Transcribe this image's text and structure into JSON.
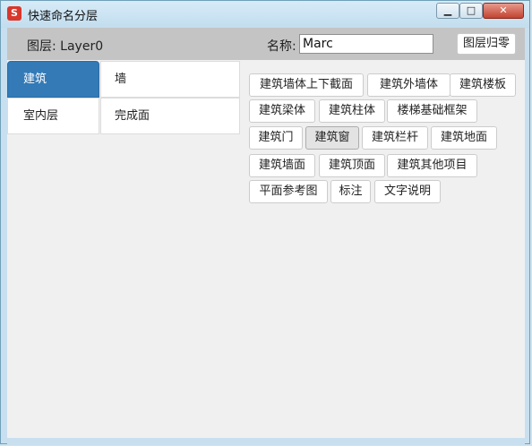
{
  "window": {
    "title": "快速命名分层",
    "min_glyph": "▁",
    "max_glyph": "□",
    "close_glyph": "✕",
    "app_icon": "S"
  },
  "header": {
    "layer_text": "图层: Layer0",
    "name_label": "名称:",
    "name_value": "Marc",
    "reset_label": "图层归零"
  },
  "categories": [
    {
      "label": "建筑"
    },
    {
      "label": "室内层"
    }
  ],
  "subcategories": [
    {
      "label": "墙"
    },
    {
      "label": "完成面"
    }
  ],
  "layer_buttons": [
    {
      "label": "建筑墙体上下截面"
    },
    {
      "label": "建筑外墙体"
    },
    {
      "label": "建筑楼板"
    },
    {
      "label": "建筑梁体"
    },
    {
      "label": "建筑柱体"
    },
    {
      "label": "楼梯基础框架"
    },
    {
      "label": "建筑门"
    },
    {
      "label": "建筑窗"
    },
    {
      "label": "建筑栏杆"
    },
    {
      "label": "建筑地面"
    },
    {
      "label": "建筑墙面"
    },
    {
      "label": "建筑顶面"
    },
    {
      "label": "建筑其他项目"
    },
    {
      "label": "平面参考图"
    },
    {
      "label": "标注"
    },
    {
      "label": "文字说明"
    }
  ],
  "colors": {
    "active_category": "#337ab7",
    "close_button": "#c2432f",
    "titlebar": "#c8dff0"
  }
}
